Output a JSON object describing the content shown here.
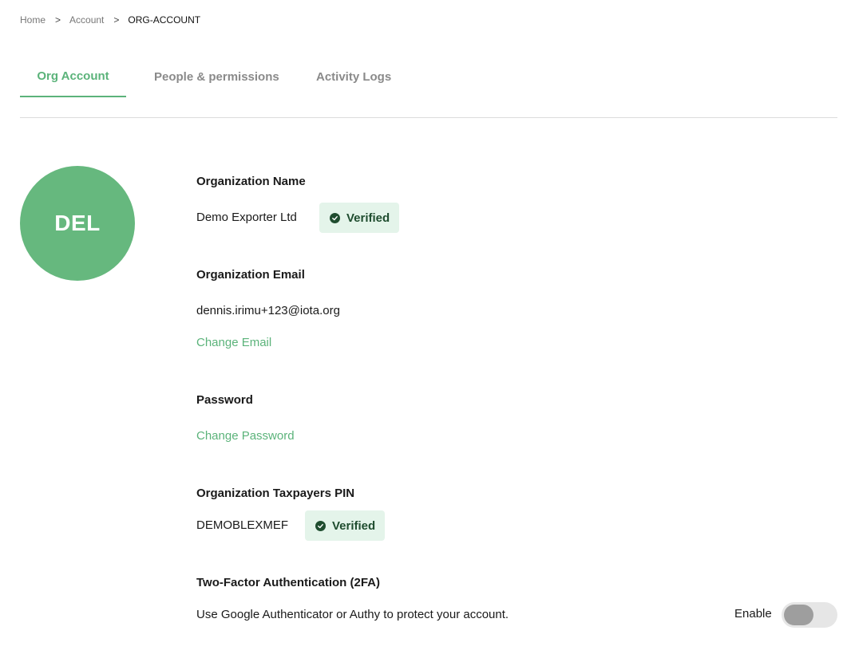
{
  "breadcrumb": {
    "items": [
      "Home",
      "Account",
      "ORG-ACCOUNT"
    ],
    "separator": ">"
  },
  "tabs": [
    {
      "label": "Org Account",
      "active": true
    },
    {
      "label": "People & permissions",
      "active": false
    },
    {
      "label": "Activity Logs",
      "active": false
    }
  ],
  "avatar": {
    "initials": "DEL",
    "color": "#66b87e"
  },
  "org_name": {
    "label": "Organization Name",
    "value": "Demo Exporter Ltd",
    "status": "Verified"
  },
  "org_email": {
    "label": "Organization Email",
    "value": "dennis.irimu+123@iota.org",
    "action": "Change Email"
  },
  "password": {
    "label": "Password",
    "action": "Change Password"
  },
  "tax_pin": {
    "label": "Organization Taxpayers PIN",
    "value": "DEMOBLEXMEF",
    "status": "Verified"
  },
  "two_factor": {
    "label": "Two-Factor Authentication (2FA)",
    "description": "Use Google Authenticator or Authy to protect your account.",
    "toggle_label": "Enable",
    "enabled": false
  },
  "colors": {
    "accent": "#5bb37a",
    "badge_bg": "#e4f4ea",
    "badge_text": "#1f4d2f"
  }
}
